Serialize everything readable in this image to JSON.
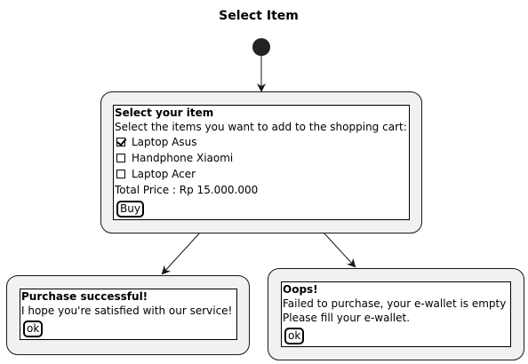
{
  "title": "Select Item",
  "select_node": {
    "header": "Select your item",
    "instruction": "Select the items you want to add to the shopping cart:",
    "items": [
      {
        "label": "Laptop Asus",
        "checked": true
      },
      {
        "label": "Handphone Xiaomi",
        "checked": false
      },
      {
        "label": "Laptop Acer",
        "checked": false
      }
    ],
    "total": "Total Price : Rp 15.000.000",
    "button": "Buy"
  },
  "success_node": {
    "header": "Purchase successful!",
    "message": "I hope you're satisfied with our service!",
    "button": "ok"
  },
  "fail_node": {
    "header": "Oops!",
    "line1": "Failed to purchase, your e-wallet is empty",
    "line2": "Please fill your e-wallet.",
    "button": "ok"
  }
}
